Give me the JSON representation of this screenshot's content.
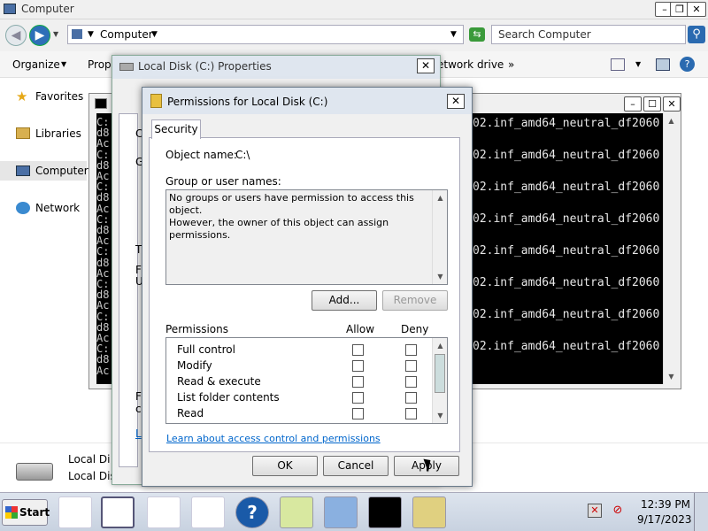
{
  "explorer": {
    "title": "Computer",
    "address": "Computer",
    "search_placeholder": "Search Computer",
    "toolbar": {
      "organize": "Organize",
      "properties_partial": "Prop",
      "map_drive_partial": "etwork drive",
      "more": "»"
    },
    "nav": {
      "favorites": "Favorites",
      "libraries": "Libraries",
      "computer": "Computer",
      "network": "Network"
    },
    "details": {
      "line1": "Local Di",
      "line2": "Local Dis"
    }
  },
  "cmd": {
    "line": "02.inf_amd64_neutral_df2060",
    "left_col": [
      "C:",
      "d8",
      "Ac",
      "C:",
      "d8",
      "Ac",
      "C:",
      "d8",
      "Ac",
      "C:",
      "d8",
      "Ac",
      "C:",
      "d8",
      "Ac",
      "C:",
      "d8",
      "Ac",
      "C:",
      "d8",
      "Ac",
      "C:",
      "d8",
      "Ac"
    ]
  },
  "props": {
    "title": "Local Disk (C:) Properties",
    "partial": {
      "a": "C",
      "b": "G",
      "c": "T",
      "d": "F",
      "e": "U",
      "f": "F",
      "g": "c",
      "h": "L"
    }
  },
  "perm": {
    "title": "Permissions for Local Disk (C:)",
    "tab": "Security",
    "object_label": "Object name:",
    "object_value": "C:\\",
    "group_label": "Group or user names:",
    "group_text1": "No groups or users have permission to access this object.",
    "group_text2": "However, the owner of this object can assign permissions.",
    "add": "Add...",
    "remove": "Remove",
    "permissions_label": "Permissions",
    "allow": "Allow",
    "deny": "Deny",
    "permissions": [
      "Full control",
      "Modify",
      "Read & execute",
      "List folder contents",
      "Read"
    ],
    "link": "Learn about access control and permissions",
    "ok": "OK",
    "cancel": "Cancel",
    "apply": "Apply"
  },
  "taskbar": {
    "start": "Start",
    "time": "12:39 PM",
    "date": "9/17/2023"
  }
}
